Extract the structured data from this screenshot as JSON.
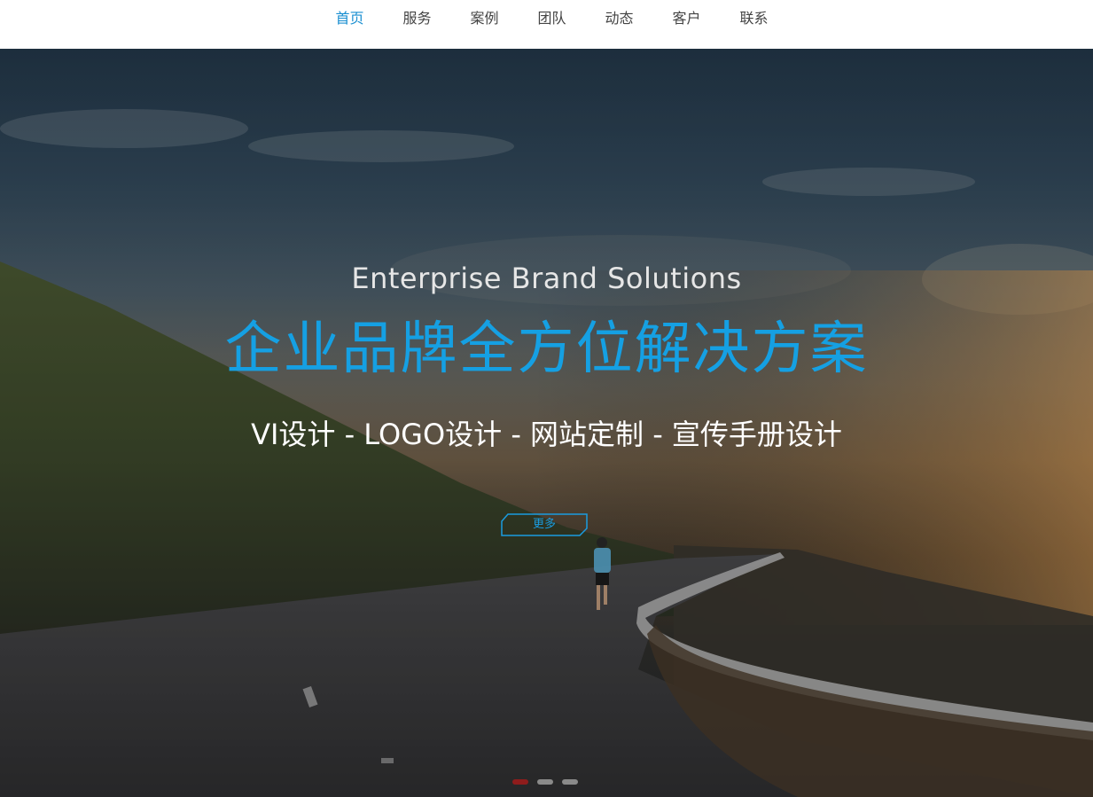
{
  "nav": {
    "items": [
      {
        "label": "首页",
        "active": true
      },
      {
        "label": "服务",
        "active": false
      },
      {
        "label": "案例",
        "active": false
      },
      {
        "label": "团队",
        "active": false
      },
      {
        "label": "动态",
        "active": false
      },
      {
        "label": "客户",
        "active": false
      },
      {
        "label": "联系",
        "active": false
      }
    ]
  },
  "hero": {
    "subtitle": "Enterprise Brand Solutions",
    "title": "企业品牌全方位解决方案",
    "services": "VI设计 - LOGO设计 - 网站定制 - 宣传手册设计",
    "more_label": "更多",
    "slides_count": 3,
    "active_slide": 1
  },
  "colors": {
    "accent": "#15a0e3",
    "nav_active": "#1a8fd1",
    "pager_active": "#8e1c1c"
  }
}
